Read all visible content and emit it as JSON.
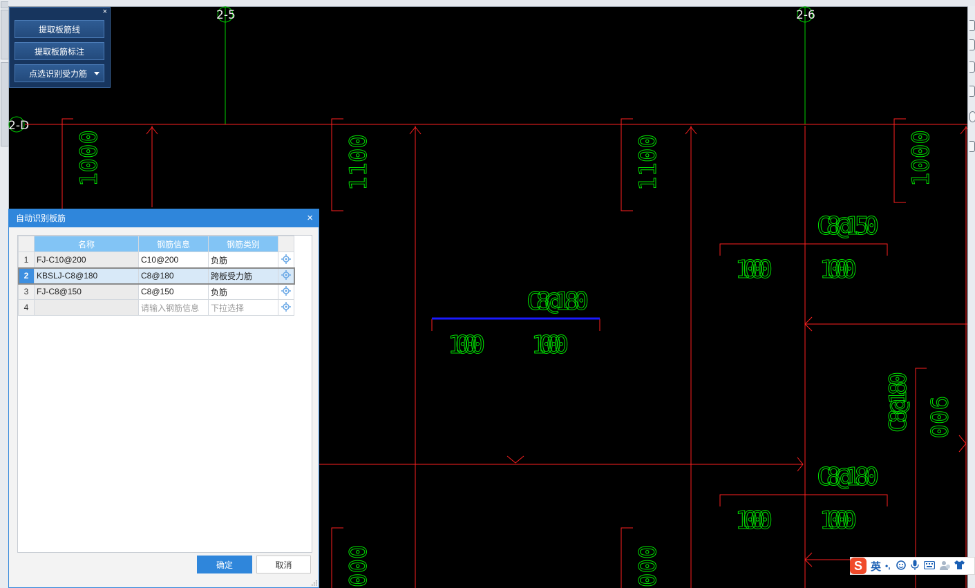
{
  "tool_panel": {
    "buttons": [
      "提取板筋线",
      "提取板筋标注",
      "点选识别受力筋"
    ],
    "close_glyph": "×"
  },
  "cad": {
    "axes": {
      "vertical": [
        "2-5",
        "2-6"
      ],
      "horizontal": [
        "2-D"
      ]
    },
    "dims": [
      "1000",
      "1100",
      "1100",
      "1000",
      "1000",
      "1000",
      "1000",
      "1000",
      "1000",
      "1000",
      "900",
      "1000",
      "1000",
      "000",
      "000"
    ],
    "rebar_labels": [
      "C8@180",
      "C8@150",
      "C8@180",
      "C8@180"
    ],
    "colors": {
      "background": "#000000",
      "lines": "#ff2020",
      "text": "#00e000",
      "axis": "#00ff00",
      "selected": "#1010ff"
    }
  },
  "dialog": {
    "title": "自动识别板筋",
    "close": "×",
    "columns": [
      "名称",
      "钢筋信息",
      "钢筋类别"
    ],
    "rows": [
      {
        "num": "1",
        "name": "FJ-C10@200",
        "info": "C10@200",
        "type": "负筋"
      },
      {
        "num": "2",
        "name": "KBSLJ-C8@180",
        "info": "C8@180",
        "type": "跨板受力筋"
      },
      {
        "num": "3",
        "name": "FJ-C8@150",
        "info": "C8@150",
        "type": "负筋"
      },
      {
        "num": "4",
        "name": "",
        "info": "请输入钢筋信息",
        "type": "下拉选择"
      }
    ],
    "ok": "确定",
    "cancel": "取消"
  },
  "ime": {
    "logo": "S",
    "mode": "英",
    "punct": "•,"
  }
}
